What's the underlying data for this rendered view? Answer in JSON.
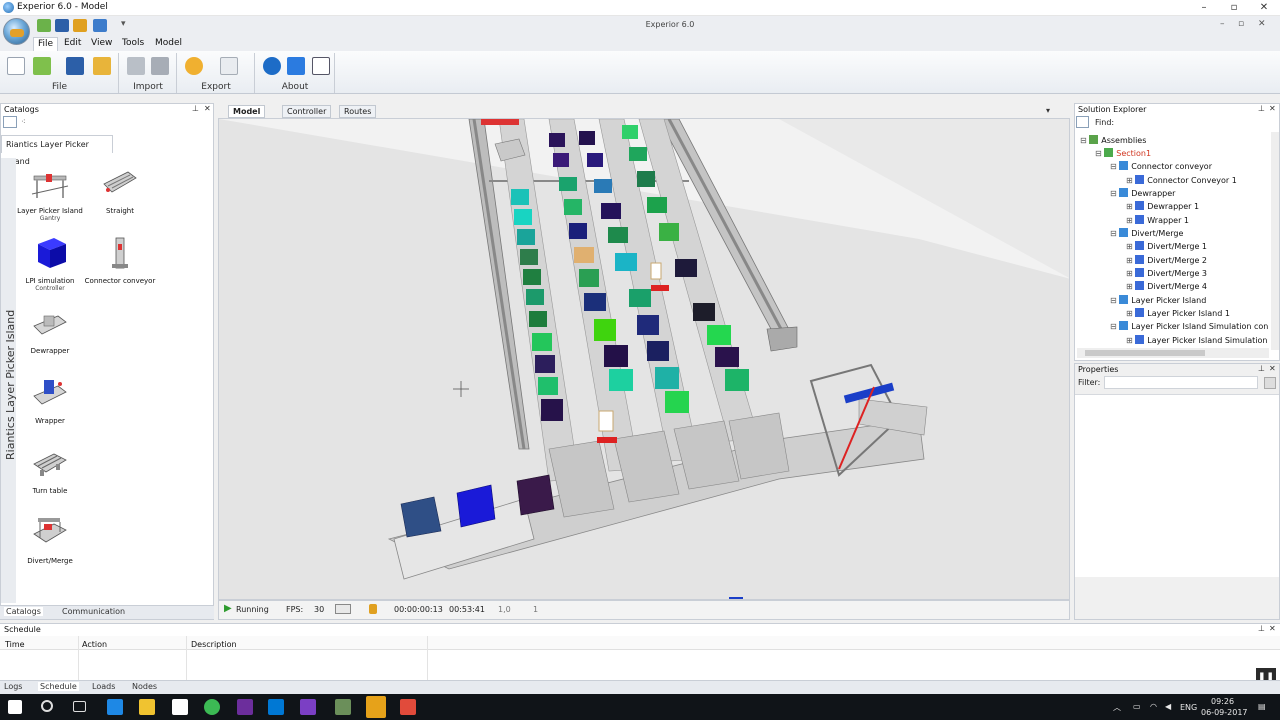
{
  "window": {
    "title": "Experior 6.0 - Model",
    "app_title": "Experior 6.0"
  },
  "menu": [
    "File",
    "Edit",
    "View",
    "Tools",
    "Model"
  ],
  "ribbon": {
    "groups": [
      "File",
      "Import",
      "Export",
      "About"
    ]
  },
  "catalogs": {
    "header": "Catalogs",
    "tab": "Riantics Layer Picker Island",
    "side_label": "Riantics Layer Picker Island",
    "items": [
      {
        "label": "Layer Picker Island",
        "sub": "Gantry"
      },
      {
        "label": "Straight",
        "sub": ""
      },
      {
        "label": "LPI simulation",
        "sub": "Controller"
      },
      {
        "label": "Connector conveyor",
        "sub": ""
      },
      {
        "label": "Dewrapper",
        "sub": ""
      },
      {
        "label": "Wrapper",
        "sub": ""
      },
      {
        "label": "Turn table",
        "sub": ""
      },
      {
        "label": "Divert/Merge",
        "sub": ""
      }
    ],
    "bottom_tabs": [
      "Catalogs",
      "Communication"
    ]
  },
  "viewport": {
    "tabs": [
      "Model",
      "Controller",
      "Routes"
    ]
  },
  "status": {
    "state": "Running",
    "fps_label": "FPS:",
    "fps": "30",
    "time_elapsed": "00:00:00:13",
    "time_total": "00:53:41",
    "speed": "1,0",
    "step": "1"
  },
  "solution_explorer": {
    "header": "Solution Explorer",
    "find_label": "Find:",
    "nodes": [
      {
        "label": "Assemblies"
      },
      {
        "label": "Section1"
      },
      {
        "label": "Connector conveyor"
      },
      {
        "label": "Connector Conveyor 1"
      },
      {
        "label": "Dewrapper"
      },
      {
        "label": "Dewrapper 1"
      },
      {
        "label": "Wrapper 1"
      },
      {
        "label": "Divert/Merge"
      },
      {
        "label": "Divert/Merge 1"
      },
      {
        "label": "Divert/Merge 2"
      },
      {
        "label": "Divert/Merge 3"
      },
      {
        "label": "Divert/Merge 4"
      },
      {
        "label": "Layer Picker Island"
      },
      {
        "label": "Layer Picker Island 1"
      },
      {
        "label": "Layer Picker Island Simulation con"
      },
      {
        "label": "Layer Picker Island Simulation"
      }
    ]
  },
  "properties": {
    "header": "Properties",
    "filter_label": "Filter:"
  },
  "schedule": {
    "header": "Schedule",
    "columns": [
      "Time",
      "Action",
      "Description"
    ],
    "tabs": [
      "Logs",
      "Schedule",
      "Loads",
      "Nodes"
    ]
  },
  "taskbar": {
    "lang": "ENG",
    "time": "09:26",
    "date": "06-09-2017"
  },
  "colors": {
    "accent": "#1f6bb3",
    "selected_node": "#d0351f",
    "running": "#2e9b2e"
  }
}
